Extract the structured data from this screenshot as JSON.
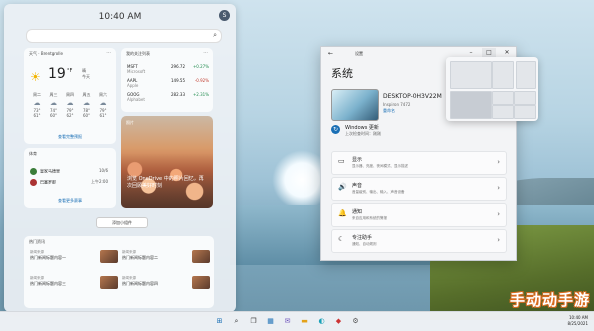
{
  "widgets": {
    "time": "10:40 AM",
    "avatar_letter": "S",
    "weather": {
      "header": "天气",
      "location": "Brentgrolle",
      "temp": "19",
      "unit": "°F",
      "condition_lines": [
        "晴",
        "今天"
      ],
      "forecast": [
        {
          "day": "周二",
          "hi": "73°",
          "lo": "61°"
        },
        {
          "day": "周三",
          "hi": "74°",
          "lo": "60°"
        },
        {
          "day": "周四",
          "hi": "79°",
          "lo": "62°"
        },
        {
          "day": "周五",
          "hi": "78°",
          "lo": "60°"
        },
        {
          "day": "周六",
          "hi": "79°",
          "lo": "61°"
        }
      ],
      "link": "查看完整预报"
    },
    "stocks": {
      "header": "我的关注列表",
      "rows": [
        {
          "sym": "MSFT",
          "name": "Microsoft",
          "val": "296.72",
          "chg": "+0.27%",
          "up": true
        },
        {
          "sym": "AAPL",
          "name": "Apple",
          "val": "149.55",
          "chg": "-0.92%",
          "up": false
        },
        {
          "sym": "GOOG",
          "name": "Alphabet",
          "val": "282.33",
          "chg": "+2.31%",
          "up": true
        }
      ]
    },
    "photos": {
      "header": "照片",
      "caption": "浏览 OneDrive 中的照片回忆，再次回顾美好时刻"
    },
    "sports": {
      "header": "体育",
      "team1": "皇家马德里",
      "team2": "巴塞罗那",
      "score_a": "10/6",
      "score_b": "上午2:00",
      "link": "查看更多赛事"
    },
    "add_widgets": "添加小组件",
    "news": {
      "header": "热门资讯",
      "items": [
        {
          "src": "新闻来源",
          "title": "热门新闻标题内容一"
        },
        {
          "src": "新闻来源",
          "title": "热门新闻标题内容二"
        },
        {
          "src": "新闻来源",
          "title": "热门新闻标题内容三"
        },
        {
          "src": "新闻来源",
          "title": "热门新闻标题内容四"
        }
      ]
    }
  },
  "settings": {
    "title": "设置",
    "heading": "系统",
    "device_name": "DESKTOP-0H3V22M",
    "device_model": "Inspiron 7472",
    "rename": "重命名",
    "wu_title": "Windows 更新",
    "wu_status": "上次检查时间：刚刚",
    "rows": [
      {
        "icon": "▭",
        "title": "显示",
        "desc": "显示器、亮度、夜间模式、显示描述"
      },
      {
        "icon": "🔊",
        "title": "声音",
        "desc": "音量级别、输出、输入、声音设备"
      },
      {
        "icon": "🔔",
        "title": "通知",
        "desc": "来自应用和系统的警报"
      },
      {
        "icon": "☾",
        "title": "专注助手",
        "desc": "通知、自动规则"
      }
    ]
  },
  "taskbar": {
    "time": "10:40 AM",
    "date": "8/25/2021"
  },
  "watermark": "手动动手游"
}
